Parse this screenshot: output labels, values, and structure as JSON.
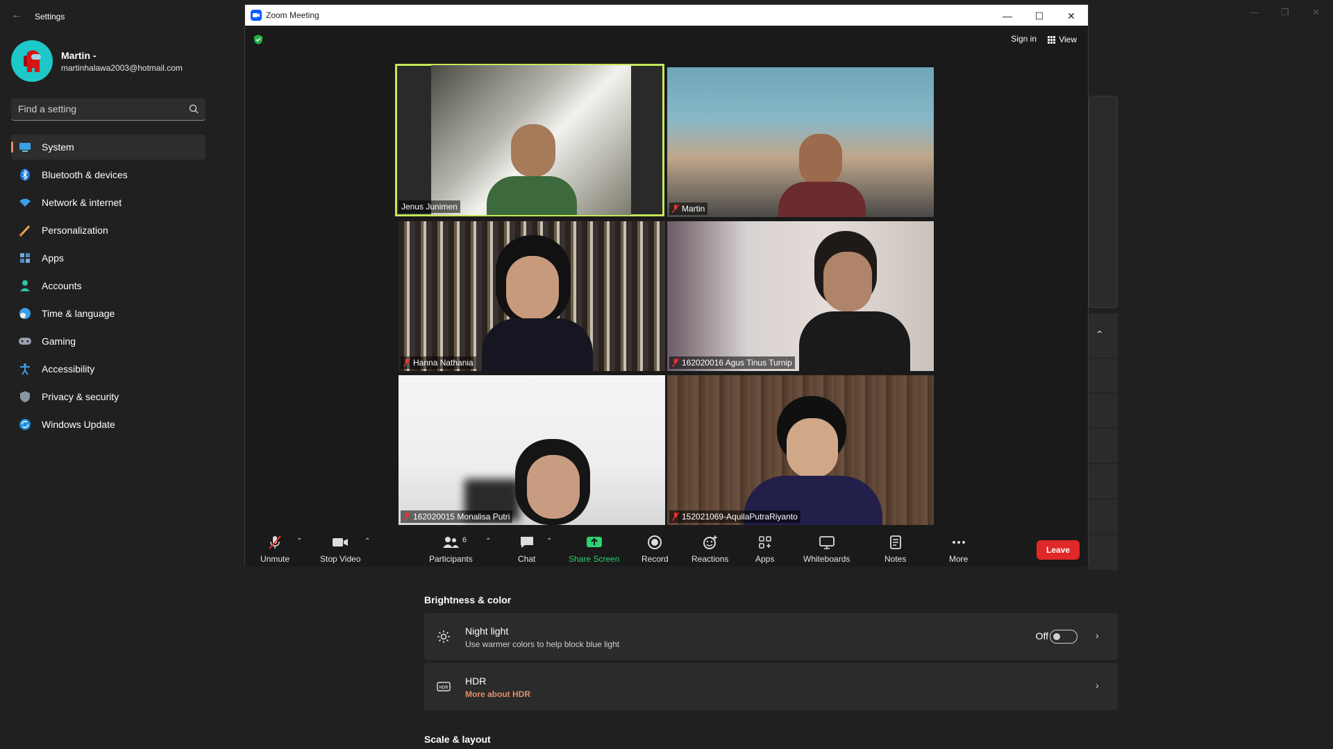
{
  "settings": {
    "title": "Settings",
    "user": {
      "name": "Martin -",
      "email": "martinhalawa2003@hotmail.com"
    },
    "search": {
      "placeholder": "Find a setting"
    },
    "nav": [
      {
        "label": "System",
        "icon": "monitor-icon"
      },
      {
        "label": "Bluetooth & devices",
        "icon": "bluetooth-icon"
      },
      {
        "label": "Network & internet",
        "icon": "wifi-icon"
      },
      {
        "label": "Personalization",
        "icon": "brush-icon"
      },
      {
        "label": "Apps",
        "icon": "apps-icon"
      },
      {
        "label": "Accounts",
        "icon": "person-icon"
      },
      {
        "label": "Time & language",
        "icon": "globe-clock-icon"
      },
      {
        "label": "Gaming",
        "icon": "gamepad-icon"
      },
      {
        "label": "Accessibility",
        "icon": "accessibility-icon"
      },
      {
        "label": "Privacy & security",
        "icon": "shield-icon"
      },
      {
        "label": "Windows Update",
        "icon": "update-icon"
      }
    ],
    "brightness_section": "Brightness & color",
    "night_light": {
      "title": "Night light",
      "subtitle": "Use warmer colors to help block blue light",
      "state": "Off"
    },
    "hdr": {
      "title": "HDR",
      "link": "More about HDR"
    },
    "scale_section": "Scale & layout",
    "accent_color": "#e28d6c"
  },
  "zoom": {
    "title": "Zoom Meeting",
    "sign_in": "Sign in",
    "view": "View",
    "participants": [
      {
        "name": "Jenus Junimen",
        "muted": false,
        "speaking": true
      },
      {
        "name": "Martin",
        "muted": true,
        "speaking": false
      },
      {
        "name": "Hanna Nathania",
        "muted": true,
        "speaking": false
      },
      {
        "name": "162020016 Agus Tinus Turnip",
        "muted": true,
        "speaking": false
      },
      {
        "name": "162020015 Monalisa Putri",
        "muted": true,
        "speaking": false
      },
      {
        "name": "152021069-AquilaPutraRiyanto",
        "muted": true,
        "speaking": false
      }
    ],
    "toolbar": {
      "unmute": "Unmute",
      "stop_video": "Stop Video",
      "participants": "Participants",
      "participants_count": "6",
      "chat": "Chat",
      "share_screen": "Share Screen",
      "record": "Record",
      "reactions": "Reactions",
      "apps": "Apps",
      "whiteboards": "Whiteboards",
      "notes": "Notes",
      "more": "More",
      "leave": "Leave"
    },
    "colors": {
      "speaking_border": "#c6e85a",
      "share_green": "#29d46e",
      "leave_red": "#e02828",
      "brand_blue": "#0b5cff"
    }
  }
}
